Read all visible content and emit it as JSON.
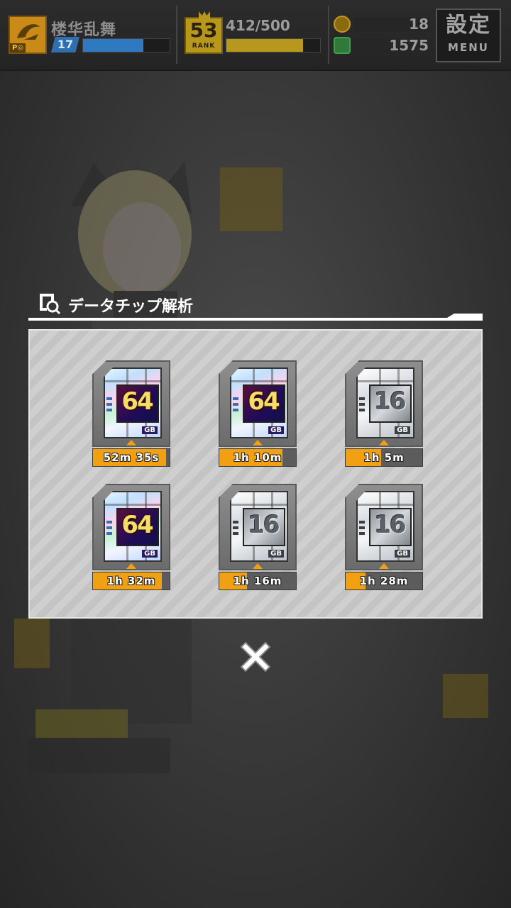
{
  "hud": {
    "player_name": "楼华乱舞",
    "player_badge": "P◎",
    "level": "17",
    "exp_fraction": 0.7,
    "rank_number": "53",
    "rank_label": "RANK",
    "stamina_text": "412/500",
    "stamina_fraction": 0.82,
    "currency_1": "18",
    "currency_2": "1575",
    "menu_jp": "設定",
    "menu_en": "MENU"
  },
  "dialog": {
    "title": "データチップ解析",
    "close_label": "close"
  },
  "chips": [
    {
      "capacity": "64",
      "unit": "GB",
      "tier": "gold",
      "timer": "52m 35s",
      "progress": 0.95
    },
    {
      "capacity": "64",
      "unit": "GB",
      "tier": "gold",
      "timer": "1h 10m",
      "progress": 0.82
    },
    {
      "capacity": "16",
      "unit": "GB",
      "tier": "silver",
      "timer": "1h 5m",
      "progress": 0.46
    },
    {
      "capacity": "64",
      "unit": "GB",
      "tier": "gold",
      "timer": "1h 32m",
      "progress": 0.9
    },
    {
      "capacity": "16",
      "unit": "GB",
      "tier": "silver",
      "timer": "1h 16m",
      "progress": 0.36
    },
    {
      "capacity": "16",
      "unit": "GB",
      "tier": "silver",
      "timer": "1h 28m",
      "progress": 0.26
    }
  ],
  "colors": {
    "accent": "#f0a010",
    "exp": "#2e79c0",
    "rank": "#b8971d"
  }
}
